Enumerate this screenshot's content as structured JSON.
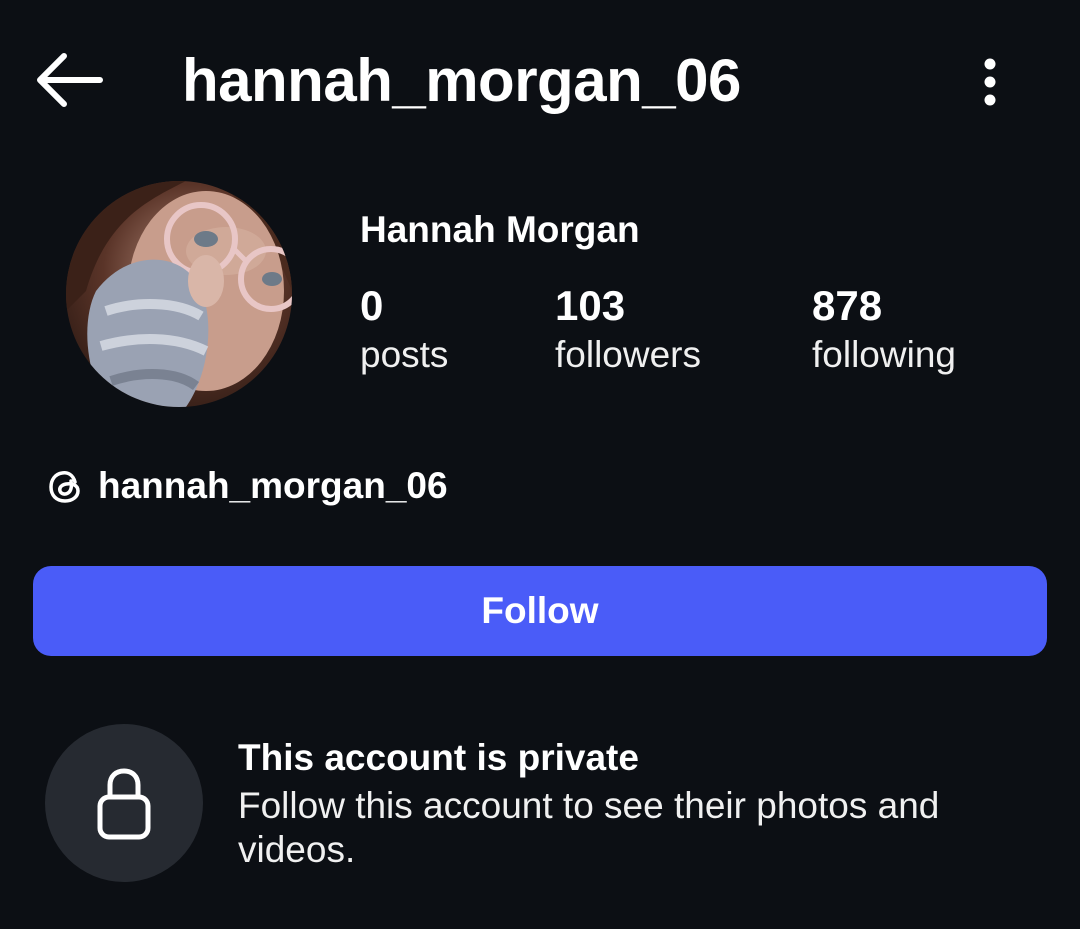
{
  "header": {
    "back_icon": "arrow-left-icon",
    "username": "hannah_morgan_06",
    "more_icon": "more-vertical-icon"
  },
  "profile": {
    "display_name": "Hannah Morgan",
    "avatar": "profile-photo",
    "stats": {
      "posts": {
        "count": "0",
        "label": "posts"
      },
      "followers": {
        "count": "103",
        "label": "followers"
      },
      "following": {
        "count": "878",
        "label": "following"
      }
    },
    "threads": {
      "icon": "threads-icon",
      "handle": "hannah_morgan_06"
    }
  },
  "actions": {
    "follow_label": "Follow"
  },
  "private_notice": {
    "icon": "lock-icon",
    "title": "This account is private",
    "description": "Follow this account to see their photos and videos."
  },
  "colors": {
    "background": "#0c0f14",
    "accent": "#4a5cf8",
    "lock_circle": "#262a31",
    "text": "#ffffff"
  }
}
